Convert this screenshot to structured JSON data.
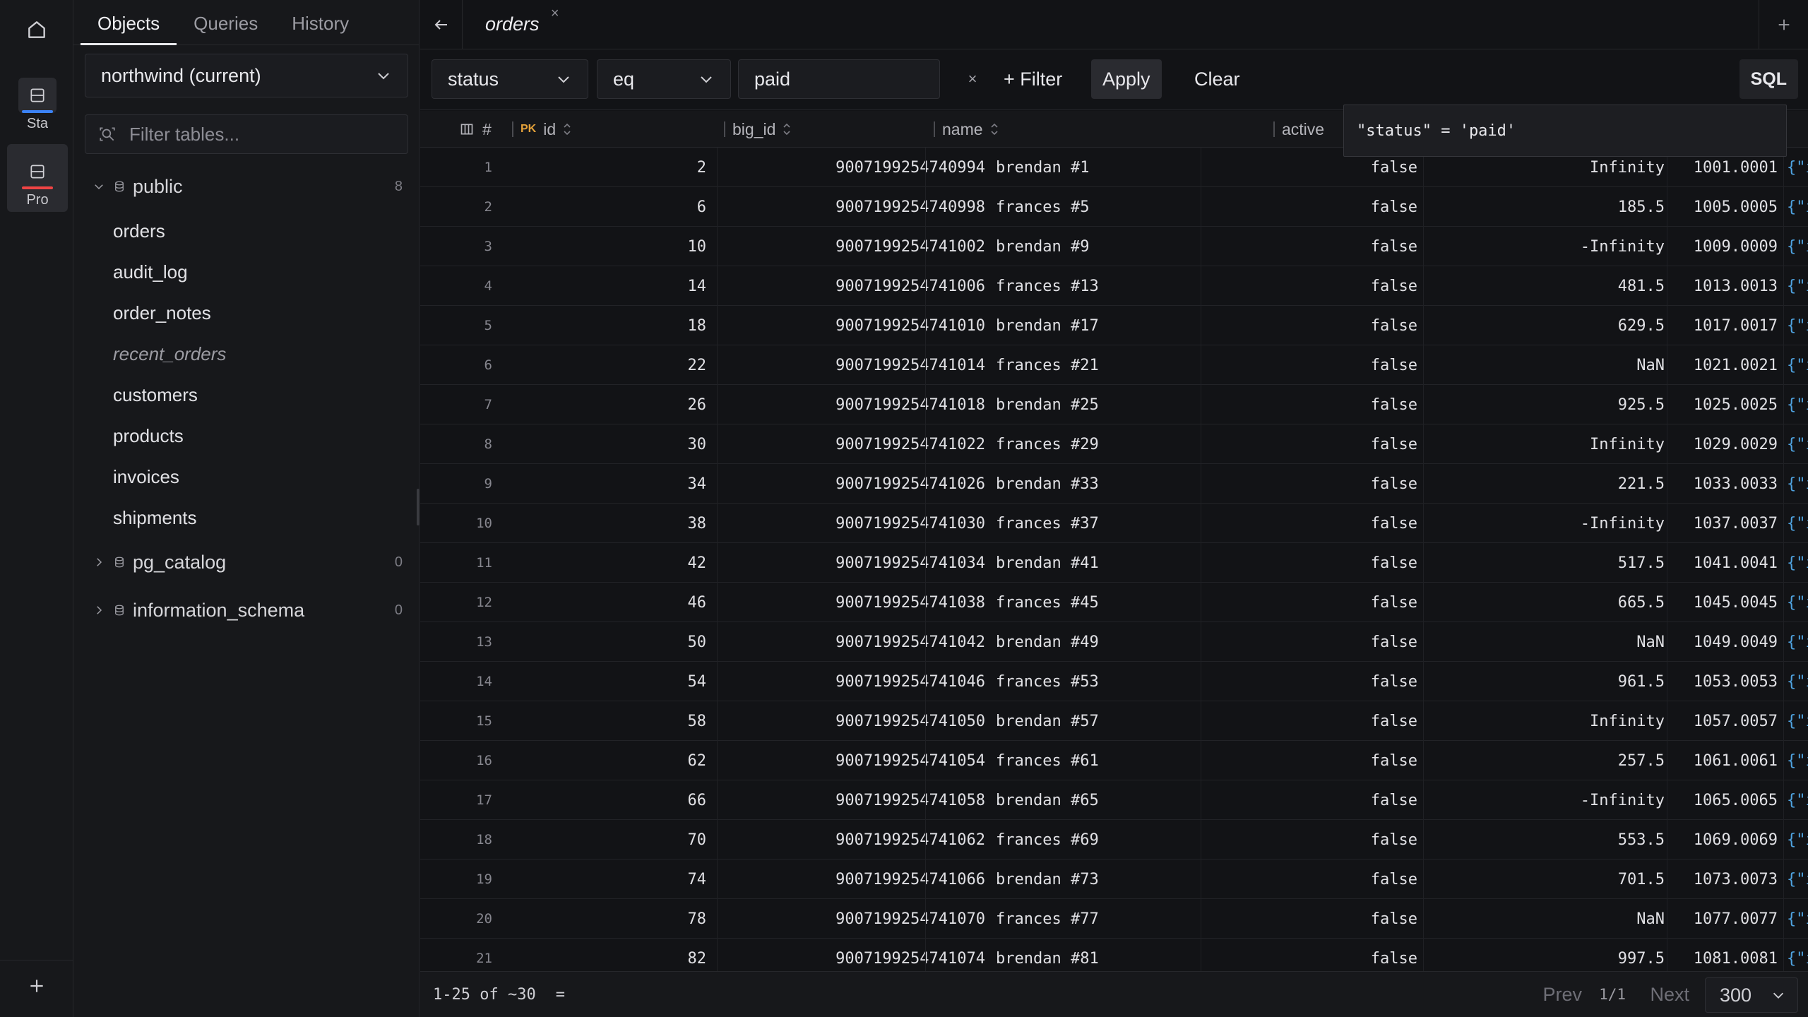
{
  "rail": {
    "connections": [
      {
        "label": "Sta",
        "accent": "#3b82f6"
      },
      {
        "label": "Pro",
        "accent": "#ef4444"
      }
    ]
  },
  "sidebar": {
    "tabs": [
      "Objects",
      "Queries",
      "History"
    ],
    "active_tab": "Objects",
    "database": "northwind (current)",
    "filter_placeholder": "Filter tables...",
    "schemas": [
      {
        "name": "public",
        "count": "8",
        "expanded": true,
        "tables": [
          {
            "name": "orders",
            "view": false
          },
          {
            "name": "audit_log",
            "view": false
          },
          {
            "name": "order_notes",
            "view": false
          },
          {
            "name": "recent_orders",
            "view": true
          },
          {
            "name": "customers",
            "view": false
          },
          {
            "name": "products",
            "view": false
          },
          {
            "name": "invoices",
            "view": false
          },
          {
            "name": "shipments",
            "view": false
          }
        ]
      },
      {
        "name": "pg_catalog",
        "count": "0",
        "expanded": false,
        "tables": []
      },
      {
        "name": "information_schema",
        "count": "0",
        "expanded": false,
        "tables": []
      }
    ]
  },
  "tab": {
    "title": "orders",
    "close": "×"
  },
  "filter": {
    "column": "status",
    "operator": "eq",
    "value": "paid",
    "clear_x": "×",
    "add_filter": "+ Filter",
    "apply": "Apply",
    "clear": "Clear",
    "sql": "SQL",
    "sql_preview": "\"status\" = 'paid'"
  },
  "grid": {
    "columns": {
      "rownum": "#",
      "pk": "PK",
      "id": "id",
      "big_id": "big_id",
      "name": "name",
      "active": "active"
    },
    "rows": [
      {
        "n": "1",
        "id": "2",
        "big_id": "9007199254740994",
        "name": "brendan #1",
        "active": "false",
        "val": "Infinity",
        "num": "1001.0001",
        "json": "{\"ind"
      },
      {
        "n": "2",
        "id": "6",
        "big_id": "9007199254740998",
        "name": "frances #5",
        "active": "false",
        "val": "185.5",
        "num": "1005.0005",
        "json": "{\"ind"
      },
      {
        "n": "3",
        "id": "10",
        "big_id": "9007199254741002",
        "name": "brendan #9",
        "active": "false",
        "val": "-Infinity",
        "num": "1009.0009",
        "json": "{\"ind"
      },
      {
        "n": "4",
        "id": "14",
        "big_id": "9007199254741006",
        "name": "frances #13",
        "active": "false",
        "val": "481.5",
        "num": "1013.0013",
        "json": "{\"ind"
      },
      {
        "n": "5",
        "id": "18",
        "big_id": "9007199254741010",
        "name": "brendan #17",
        "active": "false",
        "val": "629.5",
        "num": "1017.0017",
        "json": "{\"ind"
      },
      {
        "n": "6",
        "id": "22",
        "big_id": "9007199254741014",
        "name": "frances #21",
        "active": "false",
        "val": "NaN",
        "num": "1021.0021",
        "json": "{\"ind"
      },
      {
        "n": "7",
        "id": "26",
        "big_id": "9007199254741018",
        "name": "brendan #25",
        "active": "false",
        "val": "925.5",
        "num": "1025.0025",
        "json": "{\"ind"
      },
      {
        "n": "8",
        "id": "30",
        "big_id": "9007199254741022",
        "name": "frances #29",
        "active": "false",
        "val": "Infinity",
        "num": "1029.0029",
        "json": "{\"ind"
      },
      {
        "n": "9",
        "id": "34",
        "big_id": "9007199254741026",
        "name": "brendan #33",
        "active": "false",
        "val": "221.5",
        "num": "1033.0033",
        "json": "{\"ind"
      },
      {
        "n": "10",
        "id": "38",
        "big_id": "9007199254741030",
        "name": "frances #37",
        "active": "false",
        "val": "-Infinity",
        "num": "1037.0037",
        "json": "{\"ind"
      },
      {
        "n": "11",
        "id": "42",
        "big_id": "9007199254741034",
        "name": "brendan #41",
        "active": "false",
        "val": "517.5",
        "num": "1041.0041",
        "json": "{\"ind"
      },
      {
        "n": "12",
        "id": "46",
        "big_id": "9007199254741038",
        "name": "frances #45",
        "active": "false",
        "val": "665.5",
        "num": "1045.0045",
        "json": "{\"ind"
      },
      {
        "n": "13",
        "id": "50",
        "big_id": "9007199254741042",
        "name": "brendan #49",
        "active": "false",
        "val": "NaN",
        "num": "1049.0049",
        "json": "{\"ind"
      },
      {
        "n": "14",
        "id": "54",
        "big_id": "9007199254741046",
        "name": "frances #53",
        "active": "false",
        "val": "961.5",
        "num": "1053.0053",
        "json": "{\"ind"
      },
      {
        "n": "15",
        "id": "58",
        "big_id": "9007199254741050",
        "name": "brendan #57",
        "active": "false",
        "val": "Infinity",
        "num": "1057.0057",
        "json": "{\"ind"
      },
      {
        "n": "16",
        "id": "62",
        "big_id": "9007199254741054",
        "name": "frances #61",
        "active": "false",
        "val": "257.5",
        "num": "1061.0061",
        "json": "{\"ind"
      },
      {
        "n": "17",
        "id": "66",
        "big_id": "9007199254741058",
        "name": "brendan #65",
        "active": "false",
        "val": "-Infinity",
        "num": "1065.0065",
        "json": "{\"ind"
      },
      {
        "n": "18",
        "id": "70",
        "big_id": "9007199254741062",
        "name": "frances #69",
        "active": "false",
        "val": "553.5",
        "num": "1069.0069",
        "json": "{\"ind"
      },
      {
        "n": "19",
        "id": "74",
        "big_id": "9007199254741066",
        "name": "brendan #73",
        "active": "false",
        "val": "701.5",
        "num": "1073.0073",
        "json": "{\"ind"
      },
      {
        "n": "20",
        "id": "78",
        "big_id": "9007199254741070",
        "name": "frances #77",
        "active": "false",
        "val": "NaN",
        "num": "1077.0077",
        "json": "{\"ind"
      },
      {
        "n": "21",
        "id": "82",
        "big_id": "9007199254741074",
        "name": "brendan #81",
        "active": "false",
        "val": "997.5",
        "num": "1081.0081",
        "json": "{\"ind"
      }
    ]
  },
  "footer": {
    "range": "1-25 of ~30",
    "eq": "=",
    "prev": "Prev",
    "page": "1/1",
    "next": "Next",
    "page_size": "300"
  },
  "colors": {
    "pk": "#e5a23a",
    "json": "#4fa3e0"
  }
}
